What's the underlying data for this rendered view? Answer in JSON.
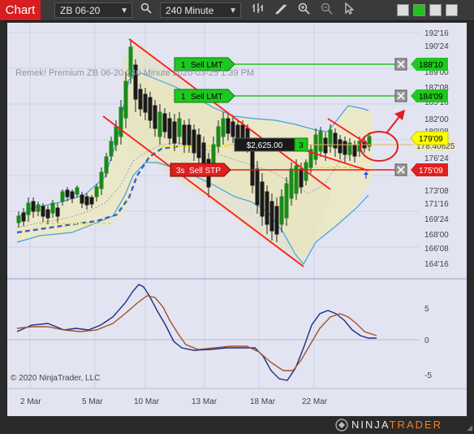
{
  "toolbar": {
    "chart_tab": "Chart",
    "instrument": "ZB 06-20",
    "interval": "240 Minute",
    "icons": [
      "search-icon",
      "bar-type-icon",
      "drawing-tool-icon",
      "zoom-in-icon",
      "zoom-out-icon",
      "cursor-icon"
    ],
    "swatch_colors": [
      "#dcdcdc",
      "#22c022",
      "#dcdcdc",
      "#dcdcdc"
    ]
  },
  "chart": {
    "watermark": "Remek!  Premium  ZB 06-20  240 Minute  2020-03-25  1:39 PM",
    "copyright": "© 2020 NinjaTrader, LLC",
    "brand": "NINJATRADER",
    "price_axis": [
      "192'16",
      "190'24",
      "189'00",
      "187'08",
      "185'16",
      "182'00",
      "180'08",
      "178'16",
      "176'24",
      "173'08",
      "171'16",
      "169'24",
      "168'00",
      "166'08",
      "164'16"
    ],
    "price_axis_extra": [
      "175'09"
    ],
    "time_axis": [
      "2 Mar",
      "5 Mar",
      "10 Mar",
      "13 Mar",
      "18 Mar",
      "22 Mar"
    ],
    "osc_axis": [
      "5",
      "0",
      "-5"
    ],
    "orders": [
      {
        "qty": "1",
        "type": "Sell LMT",
        "price": "188'10",
        "color": "#1ec81e"
      },
      {
        "qty": "1",
        "type": "Sell LMT",
        "price": "184'09",
        "color": "#1ec81e"
      },
      {
        "qty": "3s",
        "type": "Sell STP",
        "price": "175'09",
        "color": "#e01f1f"
      }
    ],
    "position": {
      "pnl": "$2,625.00",
      "qty": "3"
    },
    "last_price": "179'09",
    "crosshair_price": "178.40625",
    "colors": {
      "up_candle": "#1a8a1a",
      "down_candle": "#1a1a1a",
      "channel": "#ff1a1a",
      "band": "#4aa3e6",
      "order_green": "#1ec81e",
      "order_red": "#e01f1f",
      "last_price_bg": "#ffff00"
    }
  }
}
